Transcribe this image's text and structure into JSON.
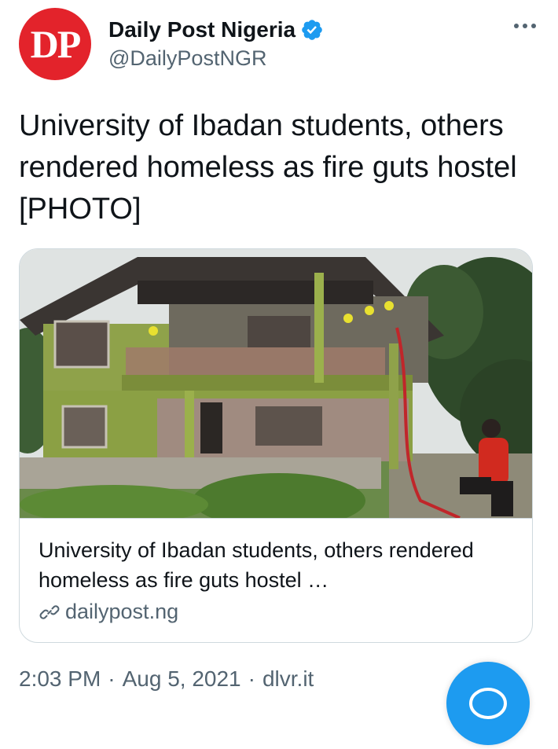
{
  "account": {
    "avatar_text": "DP",
    "display_name": "Daily Post Nigeria",
    "handle": "@DailyPostNGR",
    "verified": true
  },
  "tweet": {
    "text": "University of Ibadan students, others rendered homeless as fire guts hostel [PHOTO]"
  },
  "card": {
    "title": "University of Ibadan students, others rendered homeless as fire guts hostel …",
    "domain": "dailypost.ng"
  },
  "meta": {
    "time": "2:03 PM",
    "separator": "·",
    "date": "Aug 5, 2021",
    "source": "dlvr.it"
  },
  "colors": {
    "avatar_bg": "#e3232b",
    "verified": "#1d9bf0",
    "secondary_text": "#536471",
    "border": "#cfd9de"
  }
}
